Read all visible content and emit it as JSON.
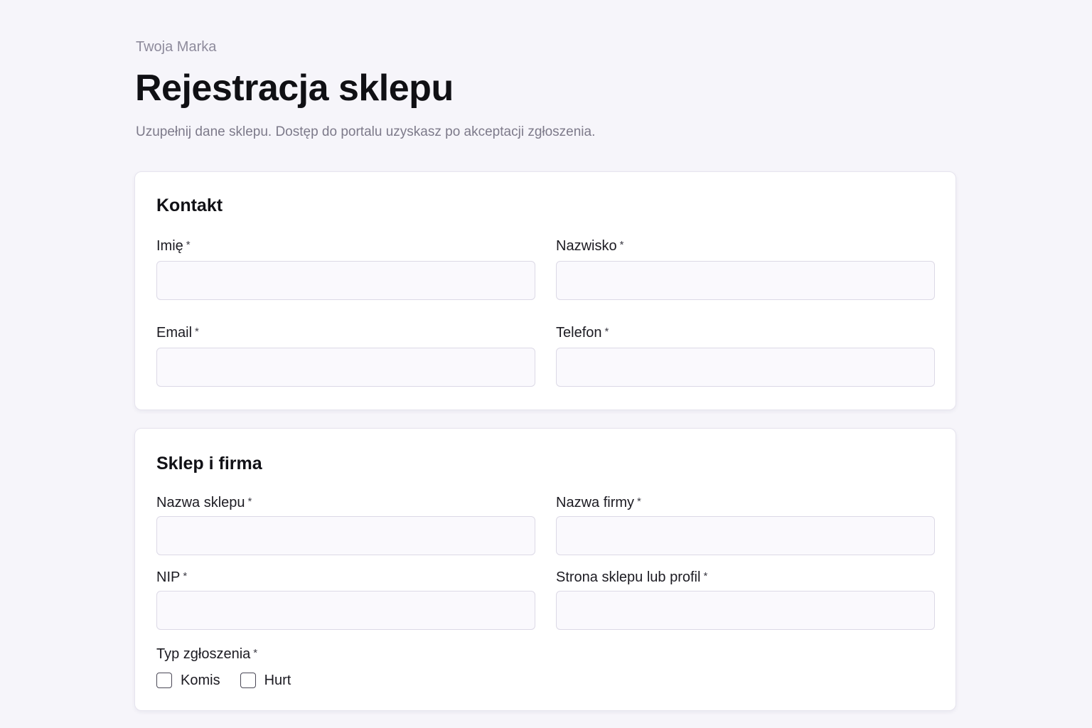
{
  "header": {
    "brand": "Twoja Marka",
    "title": "Rejestracja sklepu",
    "subtitle": "Uzupełnij dane sklepu. Dostęp do portalu uzyskasz po akceptacji zgłoszenia."
  },
  "required_marker": "*",
  "contact_section": {
    "title": "Kontakt",
    "first_name": {
      "label": "Imię",
      "value": ""
    },
    "last_name": {
      "label": "Nazwisko",
      "value": ""
    },
    "email": {
      "label": "Email",
      "value": ""
    },
    "phone": {
      "label": "Telefon",
      "value": ""
    }
  },
  "shop_section": {
    "title": "Sklep i firma",
    "shop_name": {
      "label": "Nazwa sklepu",
      "value": ""
    },
    "company_name": {
      "label": "Nazwa firmy",
      "value": ""
    },
    "nip": {
      "label": "NIP",
      "value": ""
    },
    "website": {
      "label": "Strona sklepu lub profil",
      "value": ""
    },
    "request_type": {
      "label": "Typ zgłoszenia",
      "options": [
        {
          "label": "Komis",
          "checked": false
        },
        {
          "label": "Hurt",
          "checked": false
        }
      ]
    }
  },
  "colors": {
    "background": "#f6f5fa",
    "card": "#ffffff",
    "input_background": "#faf9fd",
    "input_border": "#dcd9e6",
    "muted_text": "#8e8b9c"
  }
}
